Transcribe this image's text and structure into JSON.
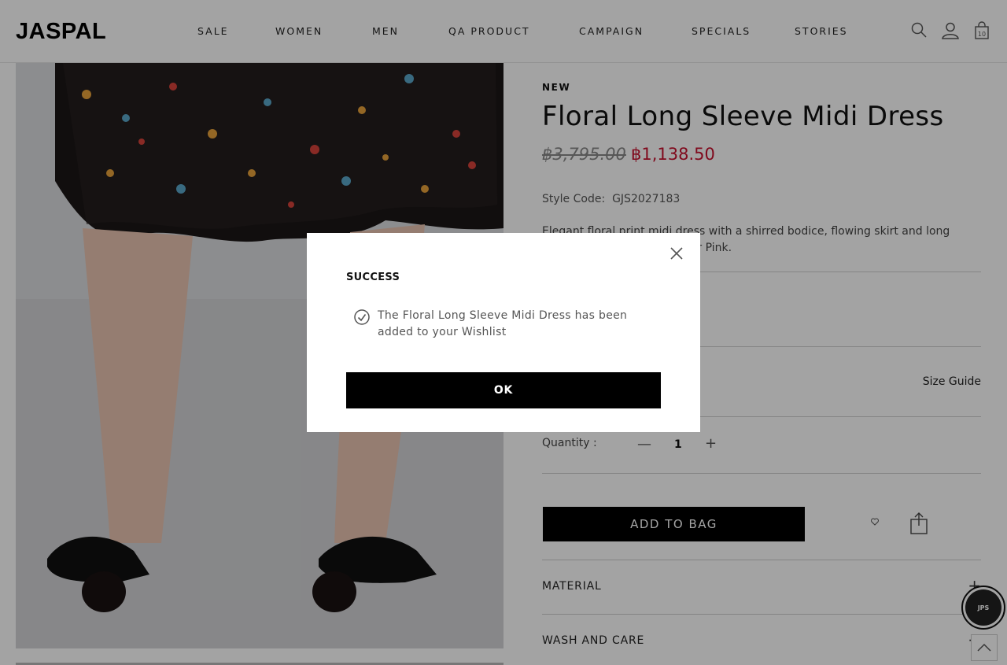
{
  "header": {
    "logo": "JASPAL",
    "nav": [
      "SALE",
      "WOMEN",
      "MEN",
      "QA PRODUCT",
      "CAMPAIGN",
      "SPECIALS",
      "STORIES"
    ],
    "bag_count": "10",
    "icons": [
      "search-icon",
      "account-icon",
      "shopping-bag-icon"
    ]
  },
  "product": {
    "badge": "NEW",
    "title": "Floral Long Sleeve Midi Dress",
    "original_price": "฿3,795.00",
    "sale_price": "฿1,138.50",
    "style_code_label": "Style Code:",
    "style_code": "GJS2027183",
    "description": "Elegant floral print midi dress with a shirred bodice, flowing skirt and long sleeves. Available in Black or Pink.",
    "size_guide": "Size Guide",
    "quantity_label": "Quantity :",
    "quantity": "1",
    "add_to_bag": "ADD TO BAG",
    "accordions": [
      "MATERIAL",
      "WASH AND CARE"
    ]
  },
  "chat": {
    "label": "JPS"
  },
  "modal": {
    "title": "SUCCESS",
    "message": "The Floral Long Sleeve Midi Dress has been added to your Wishlist",
    "ok_label": "OK"
  },
  "colors": {
    "sale_price": "#c8102e",
    "button_bg": "#000000",
    "overlay": "rgba(0,0,0,0.36)"
  }
}
